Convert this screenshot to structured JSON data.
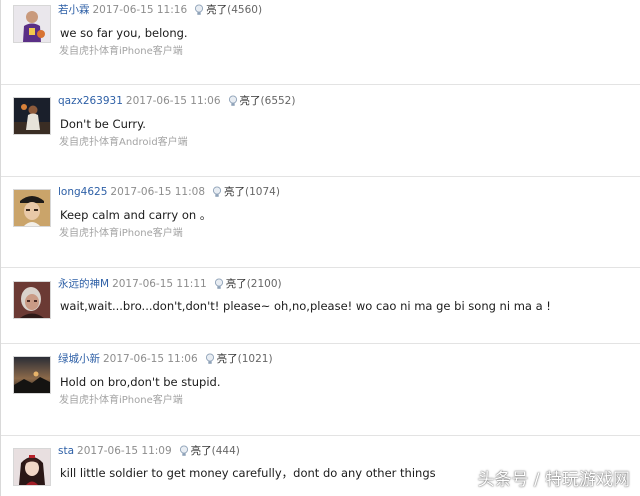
{
  "light_label": "亮了",
  "colors": {
    "username": "#2d5fa6",
    "timestamp": "#8d8d8d",
    "source": "#a4a4a4",
    "divider": "#e3e3e3"
  },
  "comments": [
    {
      "username": "若小霖",
      "time": "2017-06-15 11:16",
      "light_count": "(4560)",
      "text": "we so far you, belong.",
      "source": "发自虎扑体育iPhone客户端",
      "avatar_icon": "player-in-purple-jersey-avatar"
    },
    {
      "username": "qazx263931",
      "time": "2017-06-15 11:06",
      "light_count": "(6552)",
      "text": "Don't be Curry.",
      "source": "发自虎扑体育Android客户端",
      "avatar_icon": "basketball-player-avatar"
    },
    {
      "username": "long4625",
      "time": "2017-06-15 11:08",
      "light_count": "(1074)",
      "text": "Keep calm and carry on 。",
      "source": "发自虎扑体育iPhone客户端",
      "avatar_icon": "man-with-hat-avatar"
    },
    {
      "username": "永远的神M",
      "time": "2017-06-15 11:11",
      "light_count": "(2100)",
      "text": "wait,wait...bro...don't,don't! please~ oh,no,please! wo cao ni ma ge bi song ni ma a !",
      "source": "",
      "avatar_icon": "old-man-portrait-avatar"
    },
    {
      "username": "绿城小新",
      "time": "2017-06-15 11:06",
      "light_count": "(1021)",
      "text": "Hold on bro,don't be stupid.",
      "source": "发自虎扑体育iPhone客户端",
      "avatar_icon": "sunset-landscape-avatar"
    },
    {
      "username": "sta",
      "time": "2017-06-15 11:09",
      "light_count": "(444)",
      "text": "kill little soldier to get money carefully，dont do any other things",
      "source": "",
      "avatar_icon": "anime-girl-avatar"
    }
  ],
  "watermark": "头条号 / 特玩游戏网"
}
